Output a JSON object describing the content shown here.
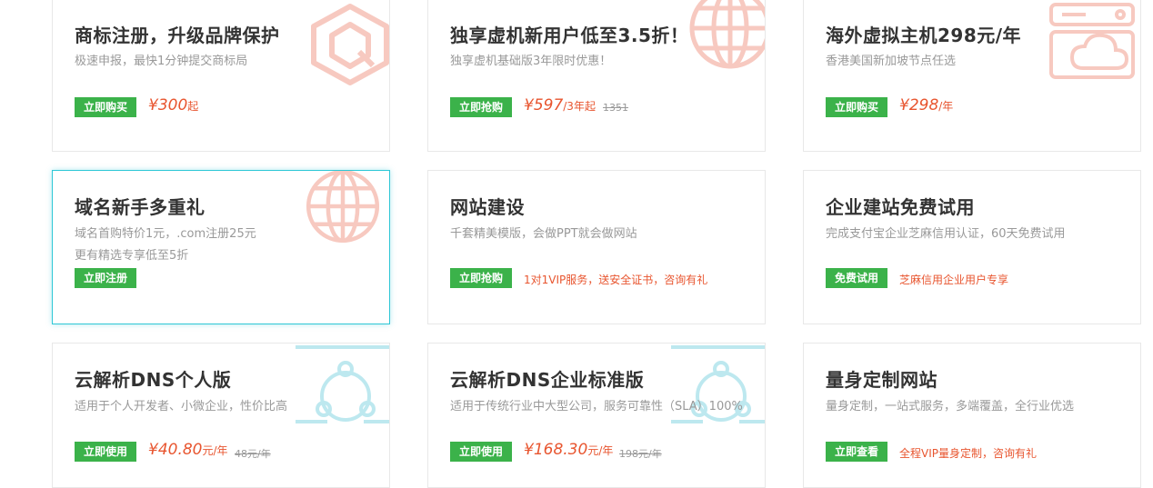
{
  "cards": [
    {
      "title": "商标注册，升级品牌保护",
      "desc": "极速申报，最快1分钟提交商标局",
      "button": "立即购买",
      "price": "¥300",
      "unit": "起",
      "icon": "trademark-icon"
    },
    {
      "title": "独享虚机新用户低至3.5折！",
      "desc": "独享虚机基础版3年限时优惠！",
      "button": "立即抢购",
      "price": "¥597",
      "unit": "/3年起",
      "old_price": "1351",
      "icon": "globe-icon"
    },
    {
      "title": "海外虚拟主机298元/年",
      "desc": "香港美国新加坡节点任选",
      "button": "立即购买",
      "price": "¥298",
      "unit": "/年",
      "icon": "cloud-server-icon"
    },
    {
      "title": "域名新手多重礼",
      "desc": "域名首购特价1元，.com注册25元",
      "desc2": "更有精选专享低至5折",
      "button": "立即注册",
      "icon": "globe-icon"
    },
    {
      "title": "网站建设",
      "desc": "千套精美模版，会做PPT就会做网站",
      "button": "立即抢购",
      "note": "1对1VIP服务，送安全证书，咨询有礼"
    },
    {
      "title": "企业建站免费试用",
      "desc": "完成支付宝企业芝麻信用认证，60天免费试用",
      "button": "免费试用",
      "note": "芝麻信用企业用户专享"
    },
    {
      "title": "云解析DNS个人版",
      "desc": "适用于个人开发者、小微企业，性价比高",
      "button": "立即使用",
      "price": "¥40.80",
      "unit": "元/年",
      "old_price": "48元/年",
      "icon": "dns-network-icon"
    },
    {
      "title": "云解析DNS企业标准版",
      "desc": "适用于传统行业中大型公司，服务可靠性（SLA）100%",
      "button": "立即使用",
      "price": "¥168.30",
      "unit": "元/年",
      "old_price": "198元/年",
      "icon": "dns-network-icon"
    },
    {
      "title": "量身定制网站",
      "desc": "量身定制，一站式服务，多端覆盖，全行业优选",
      "button": "立即查看",
      "note": "全程VIP量身定制，咨询有礼"
    }
  ],
  "colors": {
    "button_green": "#3bb24a",
    "price_red": "#e8552f",
    "active_border": "#2ec7d6",
    "deco_red": "#f5b7ab",
    "deco_cyan": "#b5e6ee"
  }
}
